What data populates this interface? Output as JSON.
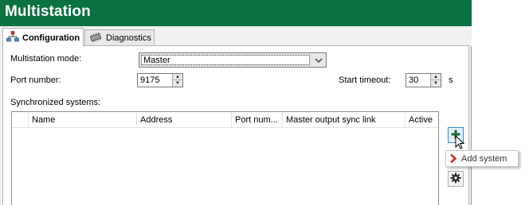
{
  "window": {
    "title": "Multistation"
  },
  "tabs": [
    {
      "label": "Configuration",
      "active": true,
      "icon": "network-icon"
    },
    {
      "label": "Diagnostics",
      "active": false,
      "icon": "chip-icon"
    }
  ],
  "form": {
    "mode_label": "Multistation mode:",
    "mode_value": "Master",
    "port_label": "Port number:",
    "port_value": "9175",
    "timeout_label": "Start timeout:",
    "timeout_value": "30",
    "timeout_unit": "s",
    "synced_label": "Synchronized systems:"
  },
  "table": {
    "columns": [
      "Name",
      "Address",
      "Port num...",
      "Master output sync link",
      "Active"
    ],
    "rows": []
  },
  "side_buttons": {
    "add_icon": "plus-icon",
    "settings_icon": "gear-icon"
  },
  "tooltip": {
    "text": "Add system",
    "icon": "chevron-right-icon"
  },
  "colors": {
    "title_bar": "#0a7140",
    "tooltip_chevron": "#d62828",
    "hover_border": "#2b8cd8"
  }
}
